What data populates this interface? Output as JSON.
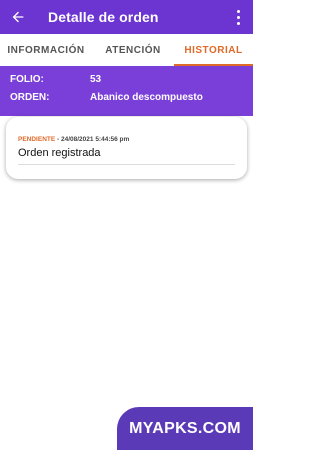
{
  "appbar": {
    "title": "Detalle de orden"
  },
  "tabs": [
    {
      "label": "INFORMACIÓN"
    },
    {
      "label": "ATENCIÓN"
    },
    {
      "label": "HISTORIAL",
      "active": true
    }
  ],
  "order": {
    "folio_label": "FOLIO:",
    "folio_value": "53",
    "orden_label": "ORDEN:",
    "orden_value": "Abanico descompuesto"
  },
  "history": [
    {
      "status": "PENDIENTE",
      "separator": " - ",
      "datetime": "24/08/2021 5:44:56 pm",
      "message": "Orden registrada"
    }
  ],
  "watermark": {
    "text": "MYAPKS.COM"
  },
  "colors": {
    "appbar": "#6c35d1",
    "header": "#7a3fd8",
    "accent": "#e06a2a"
  }
}
